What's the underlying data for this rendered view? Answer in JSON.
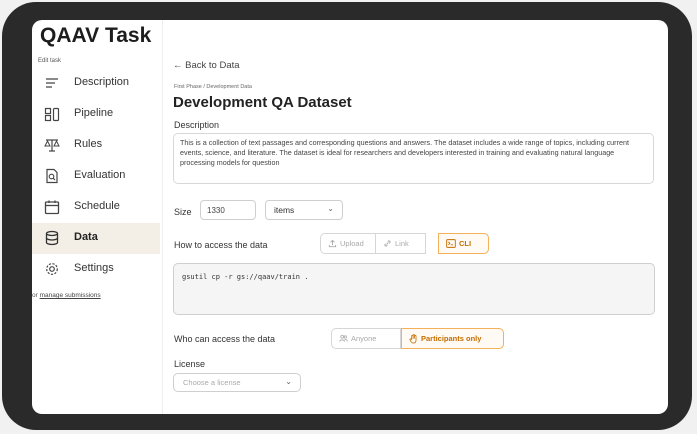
{
  "app": {
    "title": "QAAV Task",
    "edit_label": "Edit task"
  },
  "sidebar": {
    "items": [
      {
        "label": "Description",
        "icon": "description-icon"
      },
      {
        "label": "Pipeline",
        "icon": "pipeline-icon"
      },
      {
        "label": "Rules",
        "icon": "scales-icon"
      },
      {
        "label": "Evaluation",
        "icon": "evaluation-icon"
      },
      {
        "label": "Schedule",
        "icon": "calendar-icon"
      },
      {
        "label": "Data",
        "icon": "database-icon",
        "active": true
      },
      {
        "label": "Settings",
        "icon": "gear-icon"
      }
    ],
    "manage_prefix": "or ",
    "manage_link": "manage submissions"
  },
  "main": {
    "back_label": "← Back to Data",
    "breadcrumb": "First Phase / Development Data",
    "title": "Development QA Dataset",
    "description_label": "Description",
    "description": "This is a collection of text passages and corresponding questions and answers. The dataset includes a wide range of topics, including current events, science, and literature. The dataset is ideal for researchers and developers interested in training and evaluating natural language processing models for question",
    "size_label": "Size",
    "size_value": "1330",
    "size_unit": "items",
    "access_label": "How to access the data",
    "access_options": [
      {
        "label": "Upload",
        "icon": "upload-icon",
        "selected": false
      },
      {
        "label": "Link",
        "icon": "link-icon",
        "selected": false
      },
      {
        "label": "CLI",
        "icon": "terminal-icon",
        "selected": true
      }
    ],
    "command": "gsutil cp -r gs://qaav/train .",
    "who_label": "Who can access the data",
    "who_options": [
      {
        "label": "Anyone",
        "icon": "people-icon",
        "selected": false
      },
      {
        "label": "Participants only",
        "icon": "hand-icon",
        "selected": true
      }
    ],
    "license_label": "License",
    "license_placeholder": "Choose a license"
  },
  "colors": {
    "accent": "#f2b15a",
    "accent_text": "#c56d00",
    "active_bg": "#f3efe7"
  }
}
